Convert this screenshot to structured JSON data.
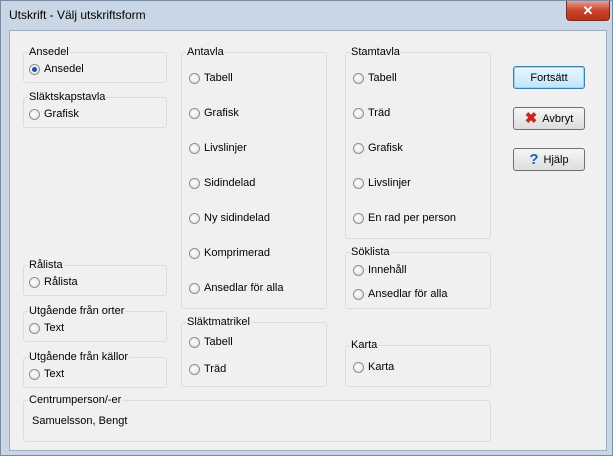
{
  "window": {
    "title": "Utskrift - Välj utskriftsform"
  },
  "icons": {
    "close": "close-icon",
    "cancel": "red-x-icon",
    "help": "question-mark-icon"
  },
  "colors": {
    "radio_dot": "#1e4f9c",
    "cancel_icon": "#c8281e",
    "help_icon": "#1a5fb4"
  },
  "groups": {
    "ansedel": {
      "label": "Ansedel",
      "options": [
        "Ansedel"
      ],
      "selected": "Ansedel"
    },
    "slaktskapstavla": {
      "label": "Släktskapstavla",
      "options": [
        "Grafisk"
      ]
    },
    "ralista": {
      "label": "Rålista",
      "options": [
        "Rålista"
      ]
    },
    "orter": {
      "label": "Utgående från orter",
      "options": [
        "Text"
      ]
    },
    "kallor": {
      "label": "Utgående från källor",
      "options": [
        "Text"
      ]
    },
    "antavla": {
      "label": "Antavla",
      "options": [
        "Tabell",
        "Grafisk",
        "Livslinjer",
        "Sidindelad",
        "Ny sidindelad",
        "Komprimerad",
        "Ansedlar för alla"
      ]
    },
    "slaktmatrikel": {
      "label": "Släktmatrikel",
      "options": [
        "Tabell",
        "Träd"
      ]
    },
    "stamtavla": {
      "label": "Stamtavla",
      "options": [
        "Tabell",
        "Träd",
        "Grafisk",
        "Livslinjer",
        "En rad per person"
      ]
    },
    "soklista": {
      "label": "Söklista",
      "options": [
        "Innehåll",
        "Ansedlar för alla"
      ]
    },
    "karta": {
      "label": "Karta",
      "options": [
        "Karta"
      ]
    },
    "centrum": {
      "label": "Centrumperson/-er",
      "value": "Samuelsson, Bengt"
    }
  },
  "buttons": {
    "ok": "Fortsätt",
    "cancel": "Avbryt",
    "help": "Hjälp"
  }
}
